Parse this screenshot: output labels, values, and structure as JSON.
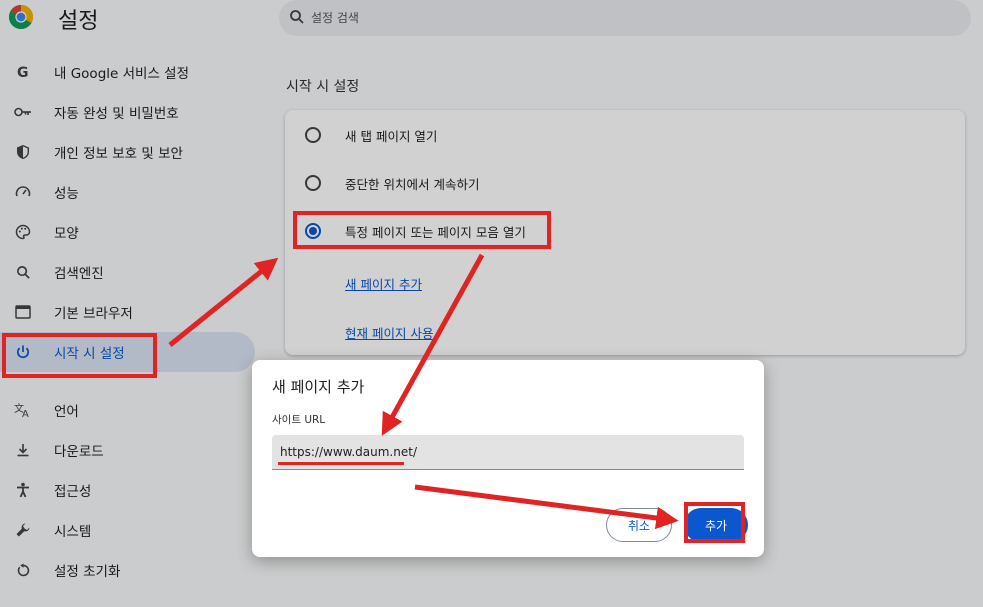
{
  "header": {
    "title": "설정"
  },
  "search": {
    "placeholder": "설정 검색"
  },
  "sidebar": {
    "items": [
      {
        "label": "내 Google 서비스 설정",
        "icon": "google-icon"
      },
      {
        "label": "자동 완성 및 비밀번호",
        "icon": "key-icon"
      },
      {
        "label": "개인 정보 보호 및 보안",
        "icon": "shield-icon"
      },
      {
        "label": "성능",
        "icon": "speedometer-icon"
      },
      {
        "label": "모양",
        "icon": "palette-icon"
      },
      {
        "label": "검색엔진",
        "icon": "search-icon"
      },
      {
        "label": "기본 브라우저",
        "icon": "browser-icon"
      },
      {
        "label": "시작 시 설정",
        "icon": "power-icon",
        "active": true
      },
      {
        "label": "언어",
        "icon": "translate-icon"
      },
      {
        "label": "다운로드",
        "icon": "download-icon"
      },
      {
        "label": "접근성",
        "icon": "accessibility-icon"
      },
      {
        "label": "시스템",
        "icon": "wrench-icon"
      },
      {
        "label": "설정 초기화",
        "icon": "reset-icon"
      }
    ]
  },
  "main": {
    "heading": "시작 시 설정",
    "options": [
      {
        "label": "새 탭 페이지 열기",
        "checked": false
      },
      {
        "label": "중단한 위치에서 계속하기",
        "checked": false
      },
      {
        "label": "특정 페이지 또는 페이지 모음 열기",
        "checked": true
      }
    ],
    "links": {
      "add_page": "새 페이지 추가",
      "use_current": "현재 페이지 사용"
    }
  },
  "dialog": {
    "title": "새 페이지 추가",
    "field_label": "사이트 URL",
    "url_value": "https://www.daum.net/",
    "cancel_label": "취소",
    "add_label": "추가"
  },
  "colors": {
    "accent": "#0b57d0",
    "annotation": "#e02424",
    "active_bg": "#d9e3f5"
  }
}
